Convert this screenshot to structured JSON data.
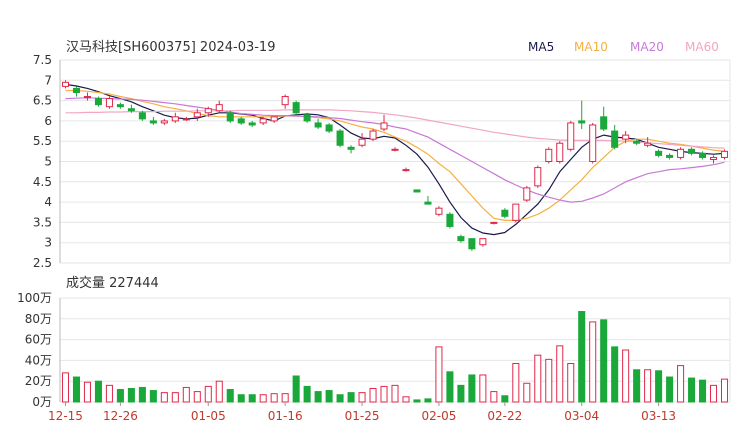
{
  "header": {
    "title": "汉马科技[SH600375] 2024-03-19"
  },
  "legend": [
    {
      "label": "MA5",
      "color": "#1a1a4e"
    },
    {
      "label": "MA10",
      "color": "#f5b041"
    },
    {
      "label": "MA20",
      "color": "#c879d8"
    },
    {
      "label": "MA60",
      "color": "#f2a6c4"
    }
  ],
  "volume_panel": {
    "title": "成交量 227444"
  },
  "colors": {
    "up": "#e0284a",
    "down": "#1aa83a"
  },
  "chart_data": [
    {
      "type": "candlestick",
      "title": "汉马科技[SH600375] 2024-03-19",
      "ylim": [
        2.5,
        7.5
      ],
      "yticks": [
        "7.5",
        "7",
        "6.5",
        "6",
        "5.5",
        "5",
        "4.5",
        "4",
        "3.5",
        "3",
        "2.5"
      ],
      "dates_shown": [
        "12-15",
        "12-26",
        "01-05",
        "01-16",
        "01-25",
        "02-05",
        "02-22",
        "03-04",
        "03-13"
      ],
      "date_tick_index": [
        0,
        5,
        13,
        20,
        27,
        34,
        40,
        47,
        54
      ],
      "grid": true,
      "ohlc": [
        [
          6.85,
          7.0,
          6.8,
          6.95
        ],
        [
          6.8,
          6.85,
          6.6,
          6.7
        ],
        [
          6.6,
          6.7,
          6.5,
          6.6
        ],
        [
          6.55,
          6.6,
          6.35,
          6.4
        ],
        [
          6.35,
          6.6,
          6.3,
          6.55
        ],
        [
          6.4,
          6.45,
          6.3,
          6.35
        ],
        [
          6.3,
          6.4,
          6.2,
          6.25
        ],
        [
          6.2,
          6.25,
          6.0,
          6.05
        ],
        [
          6.0,
          6.1,
          5.9,
          5.95
        ],
        [
          5.95,
          6.05,
          5.9,
          6.0
        ],
        [
          6.0,
          6.2,
          5.95,
          6.1
        ],
        [
          6.05,
          6.1,
          6.0,
          6.05
        ],
        [
          6.1,
          6.3,
          6.0,
          6.2
        ],
        [
          6.2,
          6.35,
          6.1,
          6.3
        ],
        [
          6.25,
          6.5,
          6.2,
          6.4
        ],
        [
          6.2,
          6.25,
          5.95,
          6.0
        ],
        [
          6.05,
          6.1,
          5.9,
          5.95
        ],
        [
          5.95,
          6.0,
          5.85,
          5.9
        ],
        [
          5.95,
          6.1,
          5.9,
          6.05
        ],
        [
          6.0,
          6.1,
          5.95,
          6.1
        ],
        [
          6.4,
          6.65,
          6.3,
          6.6
        ],
        [
          6.45,
          6.5,
          6.15,
          6.2
        ],
        [
          6.15,
          6.2,
          5.95,
          6.0
        ],
        [
          5.95,
          6.05,
          5.8,
          5.85
        ],
        [
          5.9,
          5.95,
          5.7,
          5.75
        ],
        [
          5.75,
          5.8,
          5.35,
          5.4
        ],
        [
          5.35,
          5.4,
          5.2,
          5.3
        ],
        [
          5.4,
          5.7,
          5.35,
          5.55
        ],
        [
          5.55,
          5.8,
          5.5,
          5.75
        ],
        [
          5.8,
          6.15,
          5.75,
          5.95
        ],
        [
          5.3,
          5.35,
          5.25,
          5.3
        ],
        [
          4.8,
          4.85,
          4.75,
          4.8
        ],
        [
          4.3,
          4.3,
          4.25,
          4.25
        ],
        [
          4.0,
          4.15,
          3.95,
          3.95
        ],
        [
          3.7,
          3.9,
          3.65,
          3.85
        ],
        [
          3.7,
          3.75,
          3.35,
          3.4
        ],
        [
          3.15,
          3.2,
          3.0,
          3.05
        ],
        [
          3.1,
          3.1,
          2.8,
          2.85
        ],
        [
          2.95,
          3.1,
          2.9,
          3.1
        ],
        [
          3.5,
          3.5,
          3.45,
          3.5
        ],
        [
          3.8,
          3.85,
          3.6,
          3.65
        ],
        [
          3.55,
          3.95,
          3.5,
          3.95
        ],
        [
          4.05,
          4.4,
          4.0,
          4.35
        ],
        [
          4.4,
          4.9,
          4.35,
          4.85
        ],
        [
          5.0,
          5.35,
          4.95,
          5.3
        ],
        [
          5.0,
          5.5,
          4.95,
          5.45
        ],
        [
          5.3,
          6.0,
          5.25,
          5.95
        ],
        [
          6.0,
          6.5,
          5.8,
          5.95
        ],
        [
          5.0,
          5.95,
          4.95,
          5.9
        ],
        [
          6.1,
          6.35,
          5.75,
          5.8
        ],
        [
          5.75,
          5.9,
          5.3,
          5.35
        ],
        [
          5.55,
          5.75,
          5.45,
          5.65
        ],
        [
          5.5,
          5.55,
          5.4,
          5.45
        ],
        [
          5.4,
          5.6,
          5.35,
          5.45
        ],
        [
          5.25,
          5.3,
          5.1,
          5.15
        ],
        [
          5.15,
          5.2,
          5.05,
          5.1
        ],
        [
          5.1,
          5.35,
          5.05,
          5.3
        ],
        [
          5.3,
          5.35,
          5.15,
          5.2
        ],
        [
          5.2,
          5.25,
          5.05,
          5.1
        ],
        [
          5.05,
          5.15,
          4.95,
          5.1
        ],
        [
          5.1,
          5.3,
          5.05,
          5.25
        ]
      ],
      "ma_series": [
        {
          "name": "MA5",
          "values": [
            6.9,
            6.86,
            6.8,
            6.72,
            6.62,
            6.55,
            6.47,
            6.35,
            6.25,
            6.14,
            6.08,
            6.05,
            6.07,
            6.14,
            6.2,
            6.2,
            6.17,
            6.14,
            6.06,
            6.0,
            6.12,
            6.15,
            6.17,
            6.15,
            6.08,
            5.9,
            5.7,
            5.58,
            5.56,
            5.62,
            5.58,
            5.4,
            5.18,
            4.86,
            4.45,
            4.0,
            3.62,
            3.36,
            3.24,
            3.2,
            3.25,
            3.45,
            3.7,
            3.95,
            4.3,
            4.75,
            5.05,
            5.35,
            5.55,
            5.65,
            5.6,
            5.58,
            5.55,
            5.45,
            5.35,
            5.3,
            5.25,
            5.22,
            5.2,
            5.18,
            5.2
          ]
        },
        {
          "name": "MA10",
          "values": [
            6.75,
            6.75,
            6.73,
            6.7,
            6.66,
            6.6,
            6.55,
            6.48,
            6.42,
            6.35,
            6.3,
            6.25,
            6.18,
            6.13,
            6.1,
            6.1,
            6.1,
            6.1,
            6.1,
            6.1,
            6.12,
            6.12,
            6.1,
            6.08,
            6.05,
            6.0,
            5.92,
            5.85,
            5.8,
            5.72,
            5.6,
            5.5,
            5.35,
            5.18,
            4.95,
            4.75,
            4.45,
            4.15,
            3.85,
            3.6,
            3.55,
            3.55,
            3.6,
            3.7,
            3.85,
            4.05,
            4.3,
            4.55,
            4.85,
            5.1,
            5.35,
            5.5,
            5.55,
            5.55,
            5.5,
            5.45,
            5.42,
            5.38,
            5.33,
            5.28,
            5.25
          ]
        },
        {
          "name": "MA20",
          "values": [
            6.55,
            6.56,
            6.57,
            6.56,
            6.55,
            6.54,
            6.53,
            6.51,
            6.48,
            6.45,
            6.42,
            6.38,
            6.34,
            6.3,
            6.26,
            6.22,
            6.18,
            6.16,
            6.14,
            6.13,
            6.13,
            6.12,
            6.11,
            6.1,
            6.08,
            6.06,
            6.02,
            5.98,
            5.95,
            5.91,
            5.85,
            5.8,
            5.7,
            5.6,
            5.45,
            5.3,
            5.15,
            5.0,
            4.85,
            4.7,
            4.55,
            4.42,
            4.3,
            4.2,
            4.12,
            4.05,
            4.0,
            4.02,
            4.1,
            4.2,
            4.35,
            4.5,
            4.6,
            4.7,
            4.75,
            4.8,
            4.82,
            4.85,
            4.88,
            4.92,
            4.98
          ]
        },
        {
          "name": "MA60",
          "values": [
            6.2,
            6.2,
            6.21,
            6.21,
            6.22,
            6.22,
            6.23,
            6.23,
            6.23,
            6.24,
            6.24,
            6.24,
            6.25,
            6.25,
            6.25,
            6.25,
            6.26,
            6.26,
            6.26,
            6.26,
            6.27,
            6.27,
            6.27,
            6.27,
            6.27,
            6.26,
            6.25,
            6.23,
            6.21,
            6.18,
            6.15,
            6.11,
            6.07,
            6.02,
            5.97,
            5.92,
            5.87,
            5.82,
            5.77,
            5.72,
            5.68,
            5.64,
            5.6,
            5.57,
            5.55,
            5.53,
            5.52,
            5.52,
            5.52,
            5.52,
            5.51,
            5.5,
            5.48,
            5.46,
            5.44,
            5.42,
            5.4,
            5.38,
            5.36,
            5.34,
            5.33
          ]
        }
      ]
    },
    {
      "type": "bar",
      "title": "成交量 227444",
      "ylim": [
        0,
        100
      ],
      "yticks": [
        "100万",
        "80万",
        "60万",
        "40万",
        "20万",
        "0万"
      ],
      "values": [
        28,
        24,
        19,
        20,
        16,
        12,
        13,
        14,
        11,
        9,
        9,
        14,
        10,
        15,
        20,
        12,
        7,
        7,
        7,
        8,
        8,
        25,
        15,
        10,
        11,
        7,
        9,
        9,
        13,
        15,
        16,
        5,
        2,
        3,
        53,
        29,
        16,
        26,
        26,
        10,
        6,
        37,
        18,
        45,
        41,
        54,
        37,
        87,
        77,
        79,
        53,
        50,
        31,
        31,
        30,
        24,
        35,
        23,
        21,
        16,
        22
      ]
    }
  ]
}
